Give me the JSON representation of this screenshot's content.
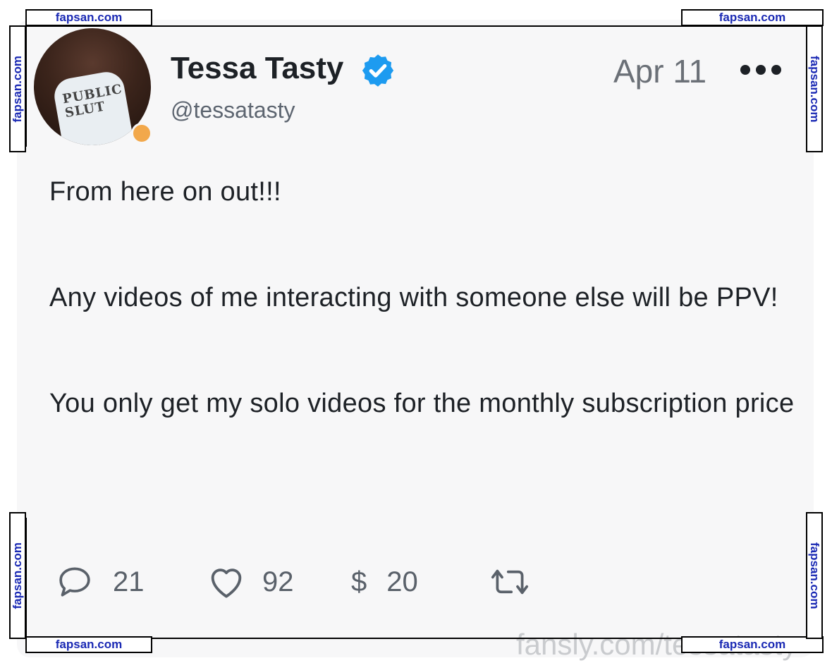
{
  "post": {
    "author": {
      "name": "Tessa Tasty",
      "handle": "@tessatasty",
      "verified": true,
      "avatar_text": "PUBLIC SLUT"
    },
    "date": "Apr 11",
    "body": {
      "line1": "From here on out!!!",
      "line2": "Any videos of me interacting with someone else will be PPV!",
      "line3": "You only get my solo videos for the monthly subscription price"
    },
    "stats": {
      "comments": "21",
      "likes": "92",
      "tips_symbol": "$",
      "tips": "20"
    }
  },
  "watermark": {
    "top_left": "fapsan.com",
    "top_right": "fapsan.com",
    "left_top": "fapsan.com",
    "right_top": "fapsan.com",
    "left_bottom": "fapsan.com",
    "right_bottom": "fapsan.com",
    "bottom_left": "fapsan.com",
    "bottom_right": "fapsan.com"
  },
  "footer": {
    "url": "fansly.com/tessatasty"
  },
  "colors": {
    "verified_blue": "#1d9bf0",
    "status_orange": "#f2a84b",
    "watermark_blue": "#1b2ab4"
  }
}
